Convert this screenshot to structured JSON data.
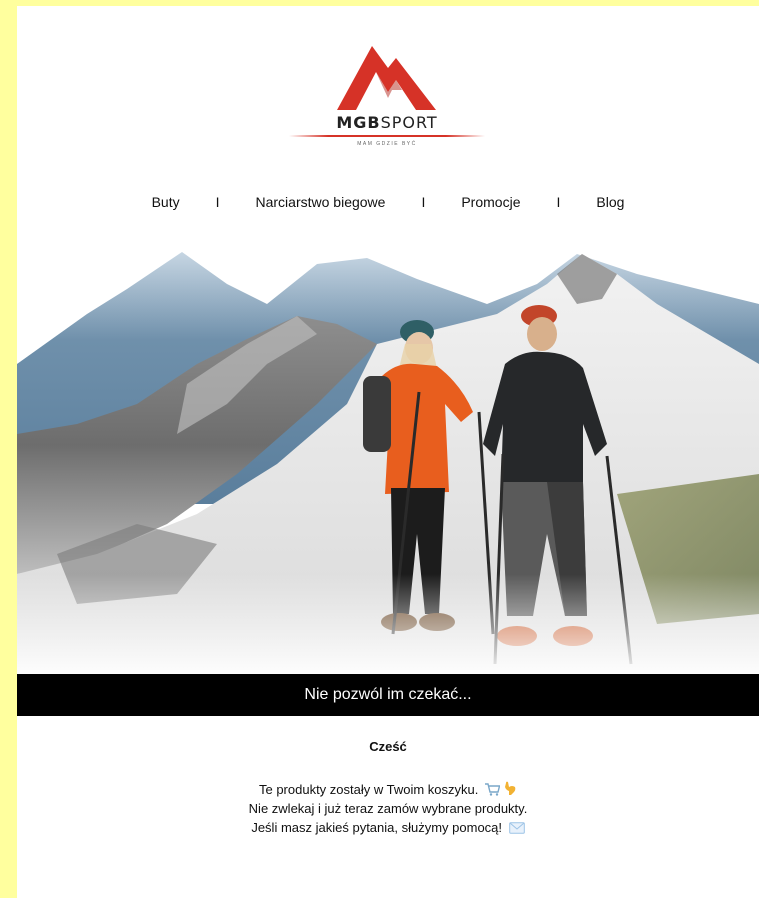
{
  "header": {
    "brand_strong": "MGB",
    "brand_rest": "SPORT",
    "tagline": "MAM GDZIE BYĆ"
  },
  "nav": {
    "items": [
      {
        "label": "Buty"
      },
      {
        "label": "Narciarstwo biegowe"
      },
      {
        "label": "Promocje"
      },
      {
        "label": "Blog"
      }
    ],
    "separator": "I"
  },
  "banner": {
    "text": "Nie pozwól im czekać..."
  },
  "content": {
    "greeting": "Cześć",
    "line1": "Te produkty zostały w Twoim koszyku.",
    "line2": "Nie zwlekaj i już teraz zamów wybrane produkty.",
    "line3": "Jeśli masz jakieś pytania, służymy pomocą!",
    "icons": [
      "shopping-cart-icon",
      "pointing-down-hand-icon",
      "envelope-icon"
    ]
  },
  "colors": {
    "page_bg": "#ffff9e",
    "logo_red": "#d63227",
    "banner_bg": "#000000"
  }
}
